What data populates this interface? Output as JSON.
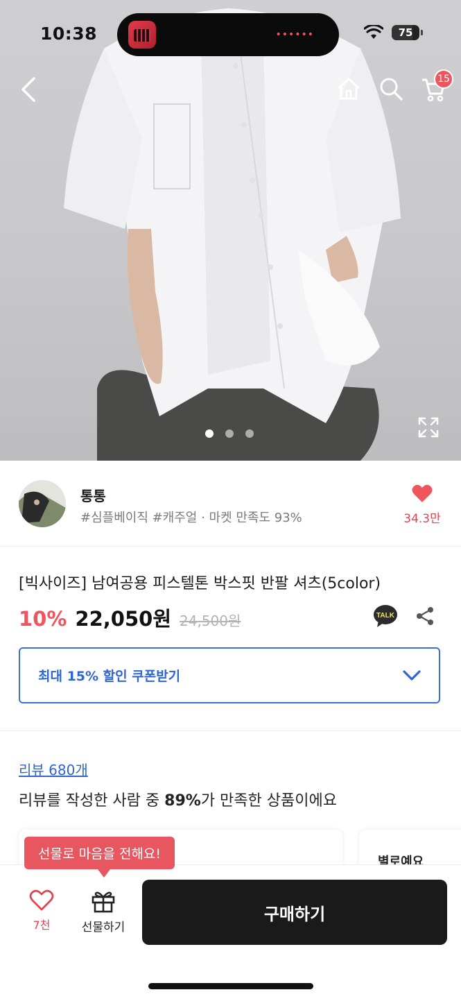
{
  "status_bar": {
    "time": "10:38",
    "battery": "75",
    "battery_level": 0.75
  },
  "nav": {
    "cart_count": "15"
  },
  "gallery": {
    "image_count": 3,
    "active_index": 0
  },
  "seller": {
    "name": "통통",
    "tags": "#심플베이직 #캐주얼 · 마켓 만족도 93%",
    "like_count": "34.3만"
  },
  "product": {
    "title": "[빅사이즈] 남여공용 피스텔톤 박스핏 반팔 셔츠(5color)",
    "discount": "10%",
    "price": "22,050원",
    "original_price": "24,500원",
    "talk_label": "TALK"
  },
  "coupon": {
    "label": "최대 15% 할인 쿠폰받기"
  },
  "review": {
    "link": "리뷰 680개",
    "summary_prefix": "리뷰를 작성한 사람 중 ",
    "summary_highlight": "89%",
    "summary_suffix": "가 만족한 상품이에요",
    "card_preview": "별로예요"
  },
  "bottom_bar": {
    "gift_tooltip": "선물로 마음을 전해요!",
    "wish_count": "7천",
    "gift_label": "선물하기",
    "buy_label": "구매하기"
  },
  "colors": {
    "accent_red": "#f0545c",
    "link_blue": "#2f64d6",
    "buy_black": "#1a1a1a"
  }
}
